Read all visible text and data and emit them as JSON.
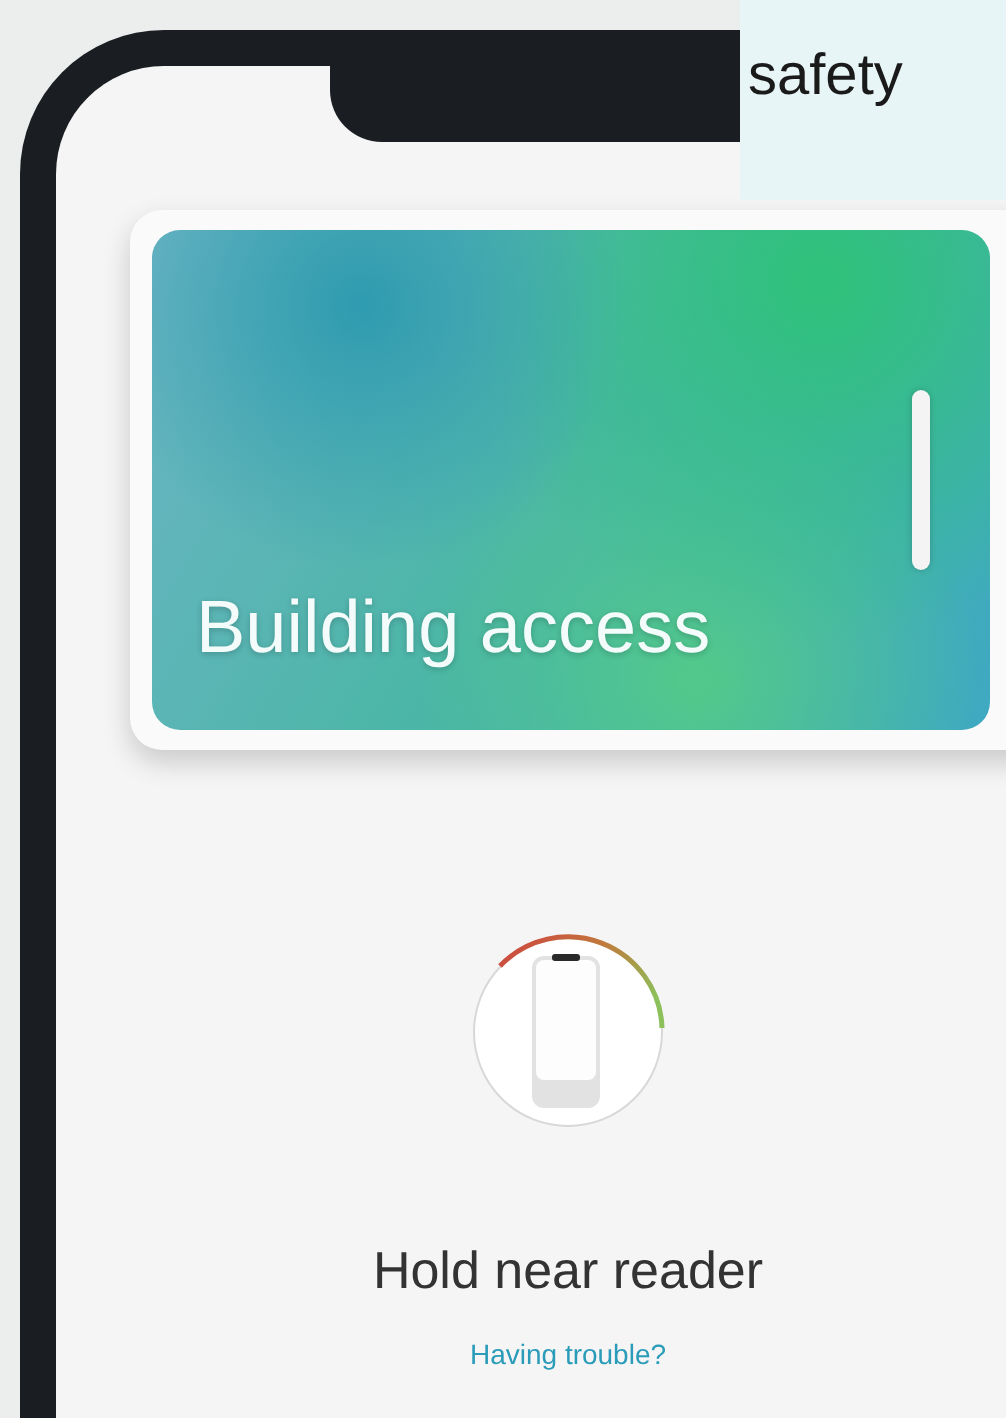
{
  "callout": {
    "text": "safety"
  },
  "card": {
    "title": "Building access"
  },
  "status": {
    "title": "Hold near reader",
    "link": "Having trouble?"
  }
}
